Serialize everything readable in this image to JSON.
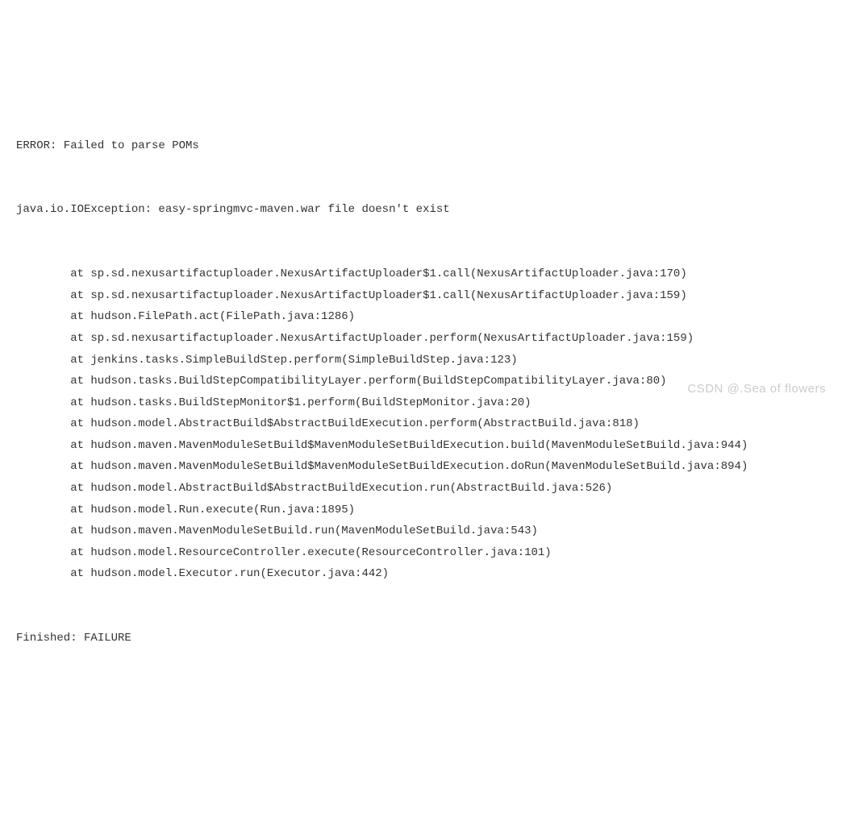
{
  "console": {
    "error_header": "ERROR: Failed to parse POMs",
    "exception": "java.io.IOException: easy-springmvc-maven.war file doesn't exist",
    "stack_trace": [
      "at sp.sd.nexusartifactuploader.NexusArtifactUploader$1.call(NexusArtifactUploader.java:170)",
      "at sp.sd.nexusartifactuploader.NexusArtifactUploader$1.call(NexusArtifactUploader.java:159)",
      "at hudson.FilePath.act(FilePath.java:1286)",
      "at sp.sd.nexusartifactuploader.NexusArtifactUploader.perform(NexusArtifactUploader.java:159)",
      "at jenkins.tasks.SimpleBuildStep.perform(SimpleBuildStep.java:123)",
      "at hudson.tasks.BuildStepCompatibilityLayer.perform(BuildStepCompatibilityLayer.java:80)",
      "at hudson.tasks.BuildStepMonitor$1.perform(BuildStepMonitor.java:20)",
      "at hudson.model.AbstractBuild$AbstractBuildExecution.perform(AbstractBuild.java:818)",
      "at hudson.maven.MavenModuleSetBuild$MavenModuleSetBuildExecution.build(MavenModuleSetBuild.java:944)",
      "at hudson.maven.MavenModuleSetBuild$MavenModuleSetBuildExecution.doRun(MavenModuleSetBuild.java:894)",
      "at hudson.model.AbstractBuild$AbstractBuildExecution.run(AbstractBuild.java:526)",
      "at hudson.model.Run.execute(Run.java:1895)",
      "at hudson.maven.MavenModuleSetBuild.run(MavenModuleSetBuild.java:543)",
      "at hudson.model.ResourceController.execute(ResourceController.java:101)",
      "at hudson.model.Executor.run(Executor.java:442)"
    ],
    "finished_line": "Finished: FAILURE"
  },
  "watermark": "CSDN @.Sea of flowers"
}
